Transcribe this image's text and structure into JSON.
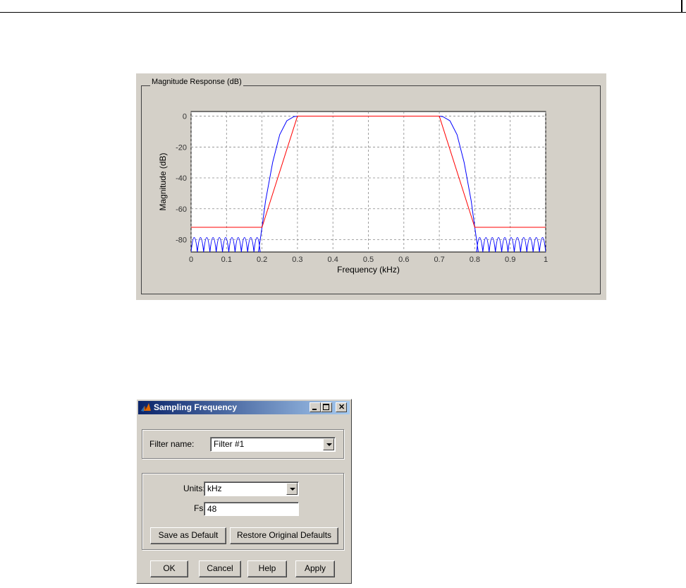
{
  "plot": {
    "group_title": "Magnitude Response (dB)",
    "chart_data": {
      "type": "line",
      "xlabel": "Frequency (kHz)",
      "ylabel": "Magnitude (dB)",
      "xlim": [
        0,
        1
      ],
      "ylim": [
        -88,
        3
      ],
      "x_ticks": [
        "0",
        "0.1",
        "0.2",
        "0.3",
        "0.4",
        "0.5",
        "0.6",
        "0.7",
        "0.8",
        "0.9",
        "1"
      ],
      "y_ticks": [
        "0",
        "-20",
        "-40",
        "-60",
        "-80"
      ],
      "grid": true,
      "series": [
        {
          "color": "#0000ff",
          "x": [
            0,
            0.19,
            0.2,
            0.21,
            0.23,
            0.25,
            0.27,
            0.29,
            0.3,
            0.7,
            0.71,
            0.73,
            0.75,
            0.77,
            0.79,
            0.8,
            0.81,
            1
          ],
          "y": [
            -88,
            -88,
            -72,
            -55,
            -30,
            -12,
            -3,
            -0.3,
            0,
            0,
            -0.3,
            -3,
            -12,
            -30,
            -55,
            -72,
            -88,
            -88
          ],
          "stopband_ripple": true
        },
        {
          "color": "#ff0000",
          "x": [
            0,
            0.2,
            0.3,
            0.7,
            0.8,
            1
          ],
          "y": [
            -72,
            -72,
            0,
            0,
            -72,
            -72
          ]
        }
      ]
    }
  },
  "dialog": {
    "title": "Sampling Frequency",
    "filter_name_label": "Filter name:",
    "filter_name_value": "Filter #1",
    "units_label": "Units:",
    "units_value": "kHz",
    "fs_label": "Fs:",
    "fs_value": "48",
    "save_default_label": "Save as Default",
    "restore_defaults_label": "Restore Original Defaults",
    "ok_label": "OK",
    "cancel_label": "Cancel",
    "help_label": "Help",
    "apply_label": "Apply",
    "icons": [
      "matlab-logo-icon",
      "minimize-icon",
      "maximize-icon",
      "close-icon",
      "chevron-down-icon"
    ]
  }
}
